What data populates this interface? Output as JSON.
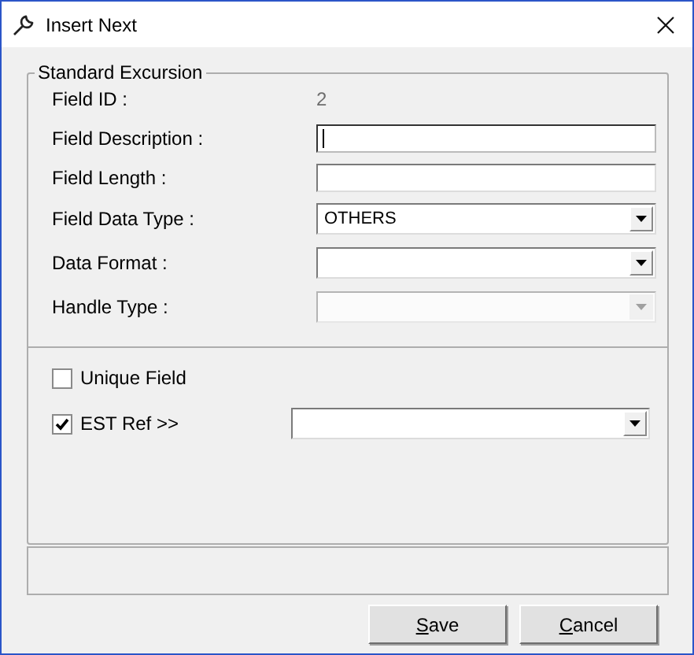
{
  "window": {
    "title": "Insert Next"
  },
  "group": {
    "legend": "Standard Excursion"
  },
  "fields": [
    {
      "kind": "readonly",
      "label": "Field ID :",
      "value": "2"
    },
    {
      "kind": "text",
      "label": "Field Description :",
      "focused": true
    },
    {
      "kind": "text",
      "label": "Field Length :",
      "focused": false
    },
    {
      "kind": "select",
      "label": "Field Data Type :",
      "value": "OTHERS",
      "disabled": false
    },
    {
      "kind": "select",
      "label": "Data Format :",
      "disabled": false
    },
    {
      "kind": "select",
      "label": "Handle Type :",
      "disabled": true
    }
  ],
  "options": [
    {
      "label": "Unique Field",
      "checked": false,
      "has_dropdown": false
    },
    {
      "label": "EST Ref >>",
      "checked": true,
      "has_dropdown": true
    }
  ],
  "buttons": [
    {
      "label": "Save",
      "first_letter_underlined": true
    },
    {
      "label": "Cancel",
      "first_letter_underlined": true
    }
  ]
}
